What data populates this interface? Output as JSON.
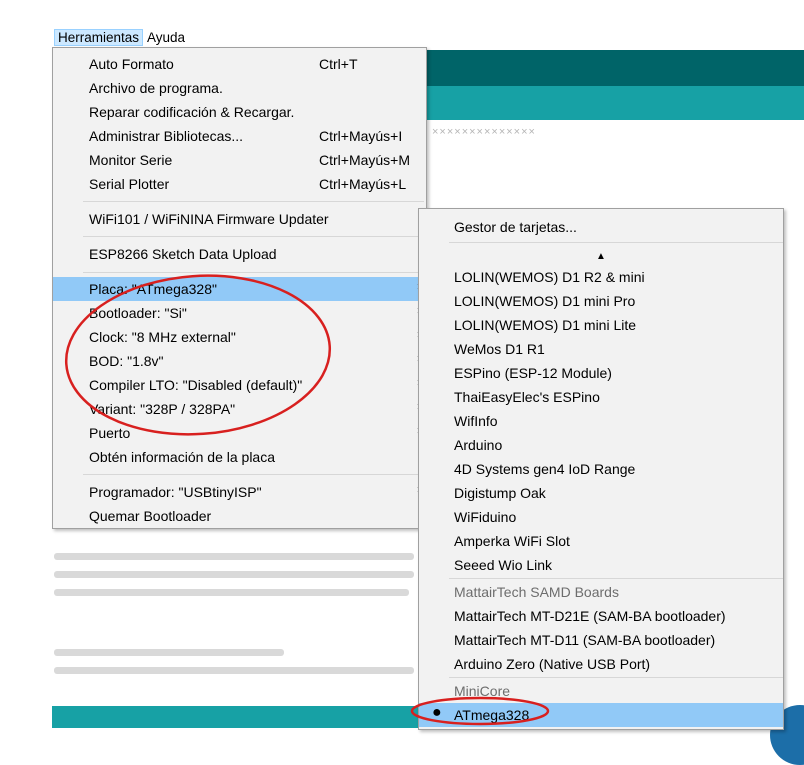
{
  "menubar": {
    "tools": "Herramientas",
    "help": "Ayuda"
  },
  "menu": {
    "auto_format": {
      "label": "Auto Formato",
      "shortcut": "Ctrl+T"
    },
    "archive": {
      "label": "Archivo de programa."
    },
    "fix_encoding": {
      "label": "Reparar codificación & Recargar."
    },
    "manage_libs": {
      "label": "Administrar Bibliotecas...",
      "shortcut": "Ctrl+Mayús+I"
    },
    "serial_monitor": {
      "label": "Monitor Serie",
      "shortcut": "Ctrl+Mayús+M"
    },
    "serial_plotter": {
      "label": "Serial Plotter",
      "shortcut": "Ctrl+Mayús+L"
    },
    "wifi_updater": {
      "label": "WiFi101 / WiFiNINA Firmware Updater"
    },
    "esp_upload": {
      "label": "ESP8266 Sketch Data Upload"
    },
    "board": {
      "label": "Placa: \"ATmega328\""
    },
    "bootloader": {
      "label": "Bootloader: \"Si\""
    },
    "clock": {
      "label": "Clock: \"8 MHz external\""
    },
    "bod": {
      "label": "BOD: \"1.8v\""
    },
    "lto": {
      "label": "Compiler LTO: \"Disabled (default)\""
    },
    "variant": {
      "label": "Variant: \"328P / 328PA\""
    },
    "port": {
      "label": "Puerto"
    },
    "board_info": {
      "label": "Obtén información de la placa"
    },
    "programmer": {
      "label": "Programador: \"USBtinyISP\""
    },
    "burn_bootloader": {
      "label": "Quemar Bootloader"
    }
  },
  "submenu": {
    "board_manager": "Gestor de tarjetas...",
    "scroll_up_icon": "▲",
    "boards": [
      "LOLIN(WEMOS) D1 R2 & mini",
      "LOLIN(WEMOS) D1 mini Pro",
      "LOLIN(WEMOS) D1 mini Lite",
      "WeMos D1 R1",
      "ESPino (ESP-12 Module)",
      "ThaiEasyElec's ESPino",
      "WifInfo",
      "Arduino",
      "4D Systems gen4 IoD Range",
      "Digistump Oak",
      "WiFiduino",
      "Amperka WiFi Slot",
      "Seeed Wio Link"
    ],
    "mattair_header": "MattairTech SAMD Boards",
    "mattair_boards": [
      "MattairTech MT-D21E (SAM-BA bootloader)",
      "MattairTech MT-D11 (SAM-BA bootloader)",
      "Arduino Zero (Native USB Port)"
    ],
    "minicore_header": "MiniCore",
    "selected_board": "ATmega328",
    "selected_marker": "●"
  },
  "background": {
    "stars": "××××××××××××××"
  },
  "colors": {
    "highlight": "#91c9f7",
    "teal_dark": "#006468",
    "teal": "#17a1a5",
    "annotation": "#d8201f"
  },
  "icons": {
    "submenu_arrow": "›"
  }
}
